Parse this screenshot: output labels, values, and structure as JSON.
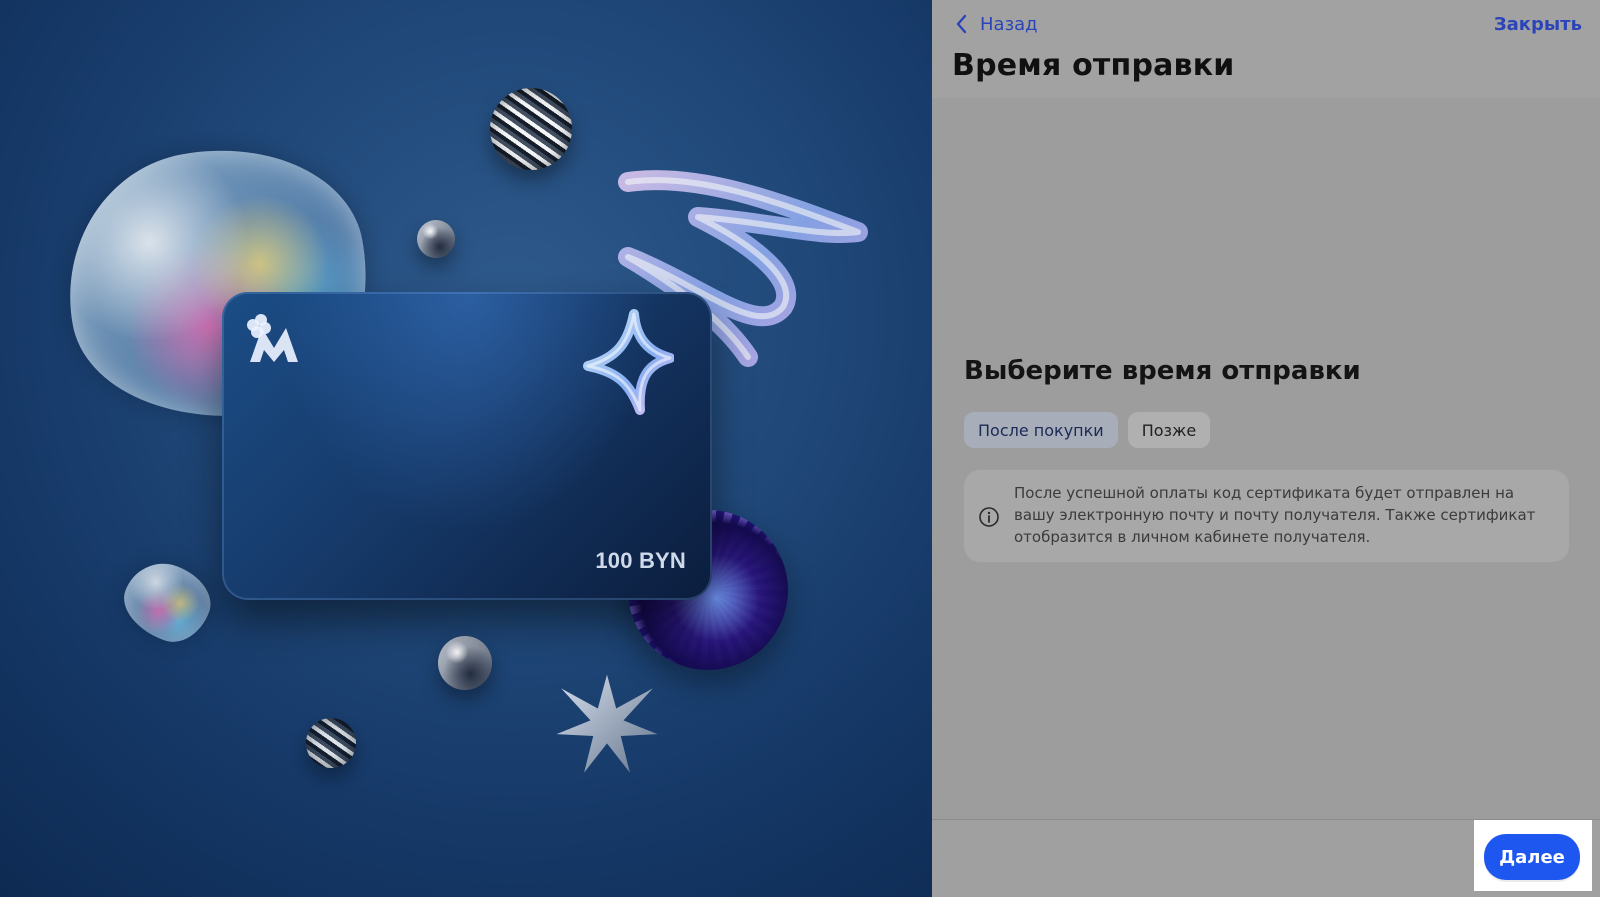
{
  "left": {
    "card": {
      "amount": "100 BYN",
      "logo_text": "M"
    }
  },
  "right": {
    "header": {
      "back_label": "Назад",
      "close_label": "Закрыть",
      "title": "Время отправки"
    },
    "content": {
      "section_title": "Выберите время отправки",
      "options": [
        {
          "label": "После покупки",
          "selected": true
        },
        {
          "label": "Позже",
          "selected": false
        }
      ],
      "info_text": "После успешной оплаты код сертификата будет отправлен на вашу электронную почту и почту получателя. Также сертификат отобразится в личном кабинете получателя."
    },
    "footer": {
      "next_label": "Далее"
    }
  },
  "colors": {
    "link": "#2b45b8",
    "primary_button": "#1e56f0",
    "panel_gray": "#9b9b9b",
    "left_bg": "#163968"
  },
  "icons": {
    "back": "chevron-left-icon",
    "info": "info-circle-icon"
  }
}
